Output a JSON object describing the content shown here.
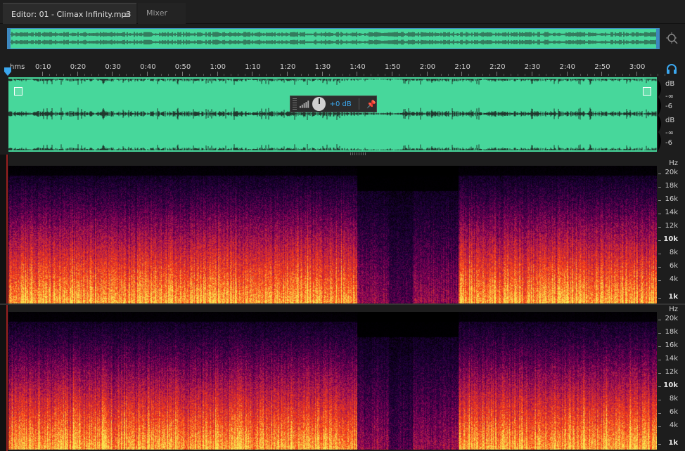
{
  "tabs": {
    "editor_label": "Editor: 01 - Climax Infinity.mp3",
    "editor_menu_icon": "≡",
    "mixer_label": "Mixer"
  },
  "ruler": {
    "unit": "hms",
    "labels": [
      "0:10",
      "0:20",
      "0:30",
      "0:40",
      "0:50",
      "1:00",
      "1:10",
      "1:20",
      "1:30",
      "1:40",
      "1:50",
      "2:00",
      "2:10",
      "2:20",
      "2:30",
      "2:40",
      "2:50",
      "3:00"
    ]
  },
  "hud": {
    "value": "+0 dB"
  },
  "db_scale": {
    "labels": [
      "dB",
      "-∞",
      "-6",
      "dB",
      "-∞",
      "-6"
    ]
  },
  "freq_scale": {
    "unit": "Hz",
    "labels": [
      "20k",
      "18k",
      "16k",
      "14k",
      "12k",
      "10k",
      "8k",
      "6k",
      "4k",
      "1k"
    ]
  },
  "colors": {
    "waveform": "#47d79b",
    "accent": "#3ba7ee",
    "background": "#1d1d1d"
  },
  "icons": {
    "zoom": "zoom-icon",
    "headphone": "headphone-icon",
    "pin": "pin-icon",
    "knob": "volume-knob-icon"
  }
}
